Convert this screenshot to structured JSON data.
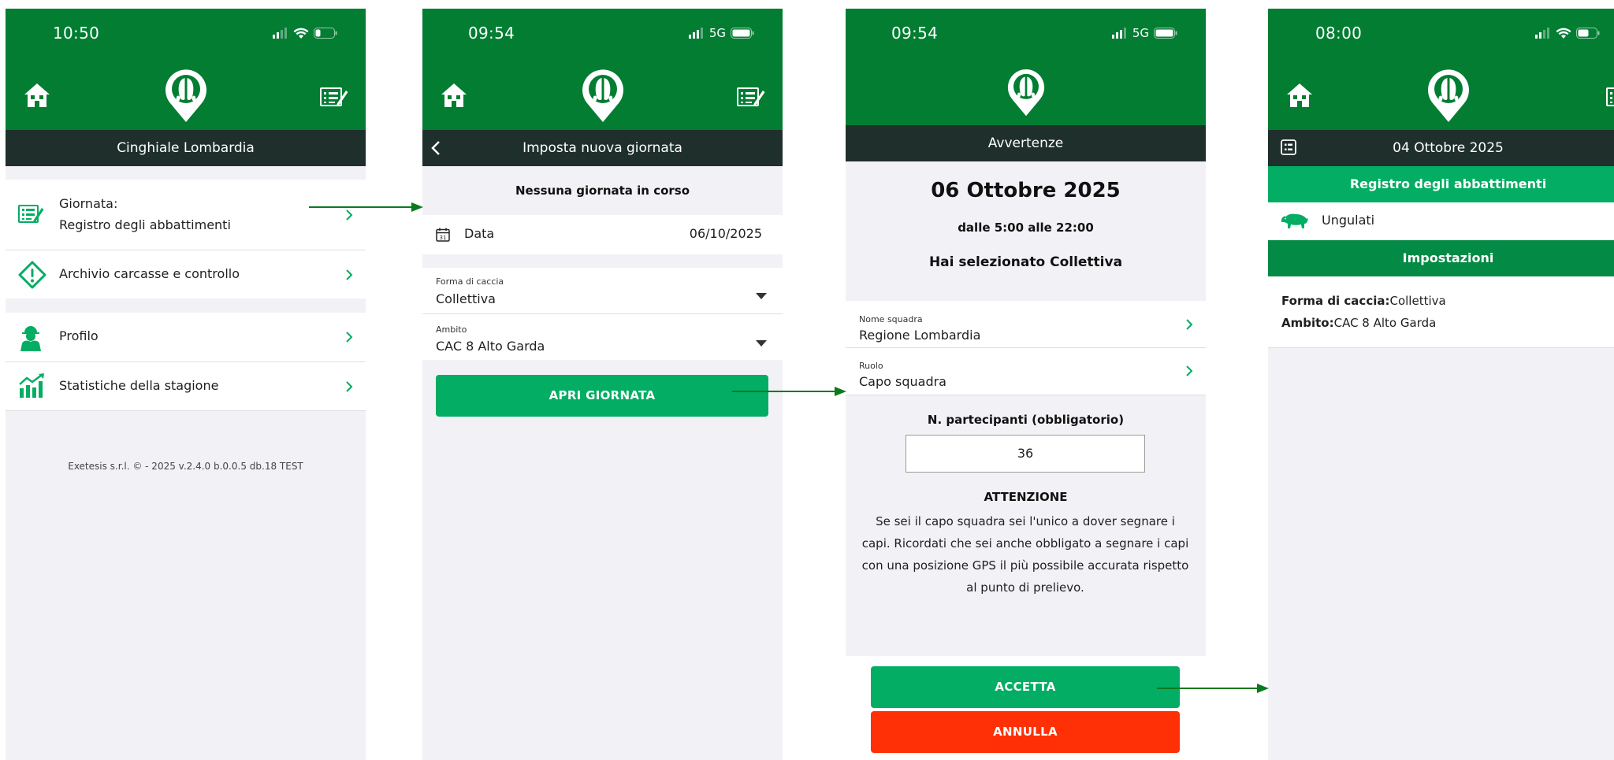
{
  "colors": {
    "primary_green": "#027d32",
    "accent_green": "#03ad63",
    "dark_bar": "#1f2f2c",
    "danger_red": "#ff2f06"
  },
  "screen1": {
    "status": {
      "time": "10:50"
    },
    "header_title": "Cinghiale Lombardia",
    "menu": [
      {
        "label_line1": "Giornata:",
        "label_line2": "Registro degli abbattimenti",
        "icon": "register-icon"
      },
      {
        "label": "Archivio carcasse e controllo",
        "icon": "warning-diamond-icon"
      },
      {
        "label": "Profilo",
        "icon": "hunter-icon"
      },
      {
        "label": "Statistiche della stagione",
        "icon": "chart-icon"
      }
    ],
    "footer": "Exetesis s.r.l. © - 2025 v.2.4.0 b.0.0.5 db.18 TEST"
  },
  "screen2": {
    "status": {
      "time": "09:54",
      "network": "5G"
    },
    "header_title": "Imposta nuova giornata",
    "no_day": "Nessuna giornata in corso",
    "date_label": "Data",
    "date_value": "06/10/2025",
    "form_caccia_label": "Forma di caccia",
    "form_caccia_value": "Collettiva",
    "ambito_label": "Ambito",
    "ambito_value": "CAC 8 Alto Garda",
    "open_button": "APRI GIORNATA"
  },
  "screen3": {
    "status": {
      "time": "09:54",
      "network": "5G"
    },
    "header_title": "Avvertenze",
    "date": "06 Ottobre 2025",
    "hours": "dalle 5:00 alle 22:00",
    "selected": "Hai selezionato Collettiva",
    "team_label": "Nome squadra",
    "team_value": "Regione Lombardia",
    "role_label": "Ruolo",
    "role_value": "Capo squadra",
    "participants_label": "N. partecipanti (obbligatorio)",
    "participants_value": "36",
    "attention_title": "ATTENZIONE",
    "attention_text": "Se sei il capo squadra sei l'unico a dover segnare i capi. Ricordati che sei anche obbligato a segnare i capi con una posizione GPS il più possibile accurata rispetto al punto di prelievo.",
    "accept_button": "ACCETTA",
    "cancel_button": "ANNULLA"
  },
  "screen4": {
    "status": {
      "time": "08:00"
    },
    "header_title": "04 Ottobre 2025",
    "registro_title": "Registro degli abbattimenti",
    "ungulati_label": "Ungulati",
    "impostazioni_title": "Impostazioni",
    "forma_label": "Forma di caccia:",
    "forma_value": "Collettiva",
    "ambito_label": "Ambito:",
    "ambito_value": "CAC 8 Alto Garda"
  }
}
